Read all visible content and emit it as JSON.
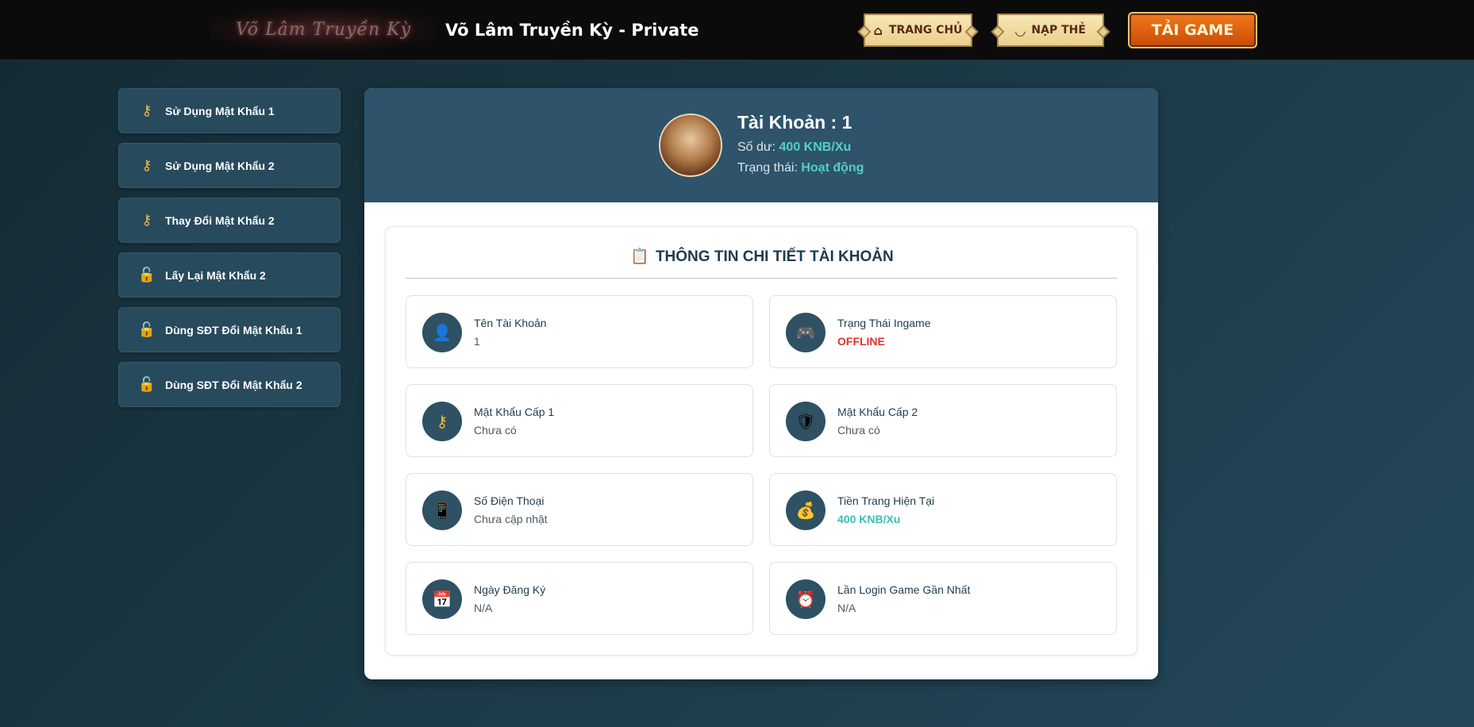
{
  "header": {
    "logo_text": "Võ Lâm Truyền Kỳ",
    "site_title": "Võ Lâm Truyền Kỳ - Private",
    "nav": [
      {
        "label": "TRANG CHỦ",
        "icon": "home-icon"
      },
      {
        "label": "NẠP THẺ",
        "icon": "ingot-icon"
      },
      {
        "label": "TẢI GAME"
      }
    ]
  },
  "sidebar": {
    "items": [
      {
        "label": "Sử Dụng Mật Khẩu 1",
        "icon": "key-icon"
      },
      {
        "label": "Sử Dụng Mật Khẩu 2",
        "icon": "key-icon"
      },
      {
        "label": "Thay Đổi Mật Khẩu 2",
        "icon": "key-icon"
      },
      {
        "label": "Lấy Lại Mật Khẩu 2",
        "icon": "unlock-icon"
      },
      {
        "label": "Dùng SĐT Đổi Mật Khẩu 1",
        "icon": "unlock-icon"
      },
      {
        "label": "Dùng SĐT Đổi Mật Khẩu 2",
        "icon": "unlock-icon"
      }
    ]
  },
  "account": {
    "title": "Tài Khoản : 1",
    "balance_label": "Số dư:",
    "balance_value": "400 KNB/Xu",
    "status_label": "Trạng thái:",
    "status_value": "Hoạt động"
  },
  "details": {
    "title": "THÔNG TIN CHI TIẾT TÀI KHOẢN",
    "fields": [
      {
        "label": "Tên Tài Khoản",
        "value": "1",
        "icon": "user-icon"
      },
      {
        "label": "Trạng Thái Ingame",
        "value": "OFFLINE",
        "icon": "gamepad-icon"
      },
      {
        "label": "Mật Khẩu Cấp 1",
        "value": "Chưa có",
        "icon": "key-icon"
      },
      {
        "label": "Mật Khẩu Cấp 2",
        "value": "Chưa có",
        "icon": "shield-icon"
      },
      {
        "label": "Số Điện Thoại",
        "value": "Chưa cập nhật",
        "icon": "phone-icon"
      },
      {
        "label": "Tiền Trang Hiện Tại",
        "value": "400 KNB/Xu",
        "icon": "money-bag-icon"
      },
      {
        "label": "Ngày Đăng Ký",
        "value": "N/A",
        "icon": "calendar-icon"
      },
      {
        "label": "Lần Login Game Gần Nhất",
        "value": "N/A",
        "icon": "alarm-clock-icon"
      }
    ]
  },
  "colors": {
    "accent_teal": "#4fd1c5",
    "offline_red": "#e0332b",
    "panel_header": "#2e536a",
    "sidebar_item": "#274a5d"
  }
}
